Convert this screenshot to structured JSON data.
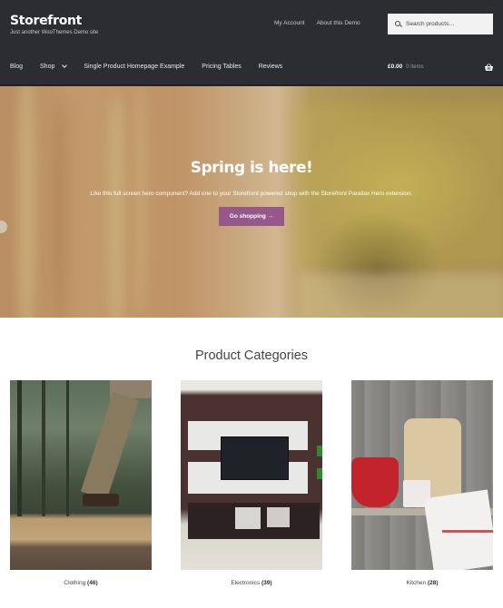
{
  "header": {
    "site_title": "Storefront",
    "site_description": "Just another WooThemes Demo site",
    "secondary_nav": [
      "My Account",
      "About this Demo"
    ],
    "search": {
      "placeholder": "Search products…",
      "value": "",
      "icon": "search-icon"
    },
    "primary_nav": [
      {
        "label": "Blog"
      },
      {
        "label": "Shop",
        "has_dropdown": true
      },
      {
        "label": "Single Product Homepage Example"
      },
      {
        "label": "Pricing Tables"
      },
      {
        "label": "Reviews"
      }
    ],
    "cart": {
      "total": "£0.00",
      "count": "0 items",
      "icon": "basket-icon"
    }
  },
  "hero": {
    "title": "Spring is here!",
    "text": "Like this full screen hero component? Add one to your Storefront powered shop with the Storefront Parallax Hero extension.",
    "button_label": "Go shopping →"
  },
  "categories": {
    "title": "Product Categories",
    "items": [
      {
        "name": "Clothing",
        "count": "(46)"
      },
      {
        "name": "Electronics",
        "count": "(39)"
      },
      {
        "name": "Kitchen",
        "count": "(28)"
      }
    ]
  },
  "colors": {
    "header_bg": "#2c2d33",
    "accent": "#96588a",
    "text": "#43454b"
  }
}
